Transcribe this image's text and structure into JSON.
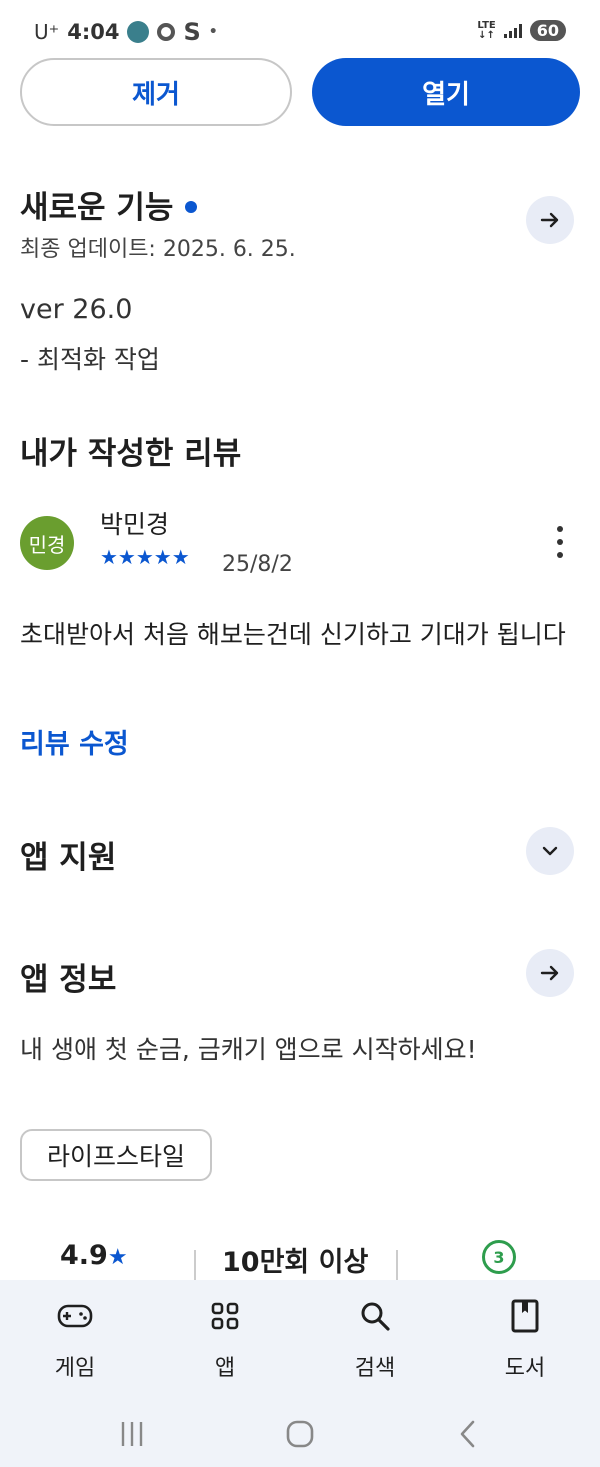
{
  "status_bar": {
    "carrier": "U⁺",
    "time": "4:04",
    "s_icon": "S",
    "dot": "•",
    "network": "LTE",
    "battery": "60"
  },
  "buttons": {
    "remove": "제거",
    "open": "열기"
  },
  "whats_new": {
    "title": "새로운 기능",
    "last_update": "최종 업데이트: 2025. 6. 25.",
    "version": "ver 26.0",
    "note": "- 최적화 작업"
  },
  "my_review": {
    "title": "내가 작성한 리뷰",
    "avatar_text": "민경",
    "reviewer": "박민경",
    "stars": "★★★★★",
    "rating": 5,
    "date": "25/8/2",
    "text": "초대받아서 처음 해보는건데 신기하고 기대가 됩니다",
    "edit_link": "리뷰 수정"
  },
  "app_support": {
    "title": "앱 지원"
  },
  "app_info": {
    "title": "앱 정보",
    "description": "내 생애 첫 순금, 금캐기 앱으로 시작하세요!",
    "category": "라이프스타일"
  },
  "stats": {
    "rating": "4.9",
    "rating_star": "★",
    "downloads": "10만회 이상",
    "age_badge": "3"
  },
  "bottom_nav": [
    {
      "label": "게임",
      "icon": "gamepad-icon"
    },
    {
      "label": "앱",
      "icon": "apps-grid-icon"
    },
    {
      "label": "검색",
      "icon": "search-icon"
    },
    {
      "label": "도서",
      "icon": "book-icon"
    }
  ],
  "colors": {
    "accent": "#0b57d0",
    "avatar": "#6a9e2f",
    "badge": "#2e9d4d",
    "nav_bg": "#f0f3f9"
  }
}
